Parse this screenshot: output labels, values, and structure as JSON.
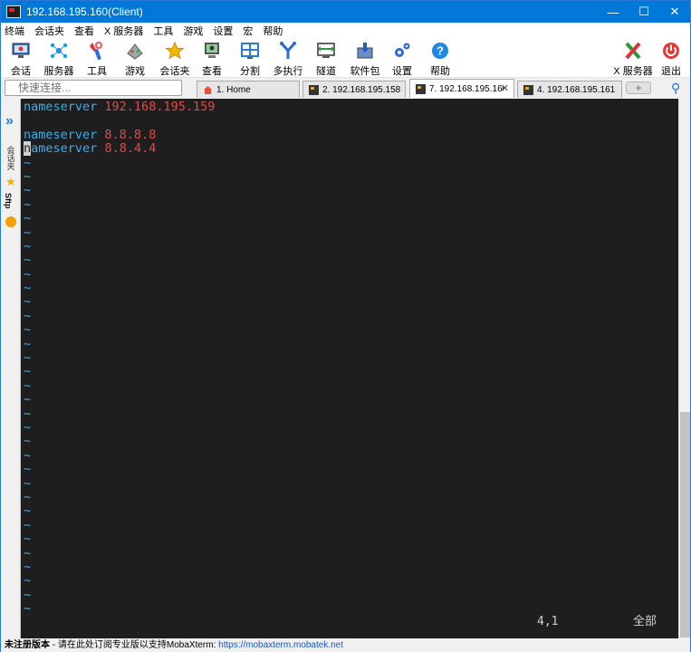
{
  "window": {
    "title": "192.168.195.160(Client)",
    "controls": {
      "minimize": "—",
      "maximize": "☐",
      "close": "✕"
    }
  },
  "menu": [
    "终端",
    "会话夹",
    "查看",
    "X 服务器",
    "工具",
    "游戏",
    "设置",
    "宏",
    "帮助"
  ],
  "toolbar": {
    "left": [
      {
        "label": "会话",
        "icon": "session-icon"
      },
      {
        "label": "服务器",
        "icon": "servers-icon"
      },
      {
        "label": "工具",
        "icon": "tools-icon"
      },
      {
        "label": "游戏",
        "icon": "games-icon"
      },
      {
        "label": "会话夹",
        "icon": "star-icon"
      },
      {
        "label": "查看",
        "icon": "view-icon"
      },
      {
        "label": "分割",
        "icon": "split-icon"
      },
      {
        "label": "多执行",
        "icon": "multiexec-icon"
      },
      {
        "label": "隧道",
        "icon": "tunnel-icon"
      },
      {
        "label": "软件包",
        "icon": "packages-icon"
      },
      {
        "label": "设置",
        "icon": "settings-icon"
      },
      {
        "label": "帮助",
        "icon": "help-icon"
      }
    ],
    "right": [
      {
        "label": "X 服务器",
        "icon": "x-server-icon"
      },
      {
        "label": "退出",
        "icon": "power-icon"
      }
    ]
  },
  "quick_connect": {
    "placeholder": "快速连接..."
  },
  "tabs": [
    {
      "label": "1. Home",
      "icon": "home-icon",
      "active": false
    },
    {
      "label": "2. 192.168.195.158",
      "icon": "terminal-tab-icon",
      "active": false
    },
    {
      "label": "7. 192.168.195.160",
      "icon": "terminal-tab-icon",
      "active": true
    },
    {
      "label": "4. 192.168.195.161",
      "icon": "terminal-tab-icon",
      "active": false
    }
  ],
  "sidebar": {
    "sessions_label": "会话夹",
    "sftp_label": "Sftp"
  },
  "terminal": {
    "lines": [
      {
        "keyword": "nameserver",
        "value": "192.168.195.159"
      },
      {
        "keyword": "",
        "value": ""
      },
      {
        "keyword": "nameserver",
        "value": "8.8.8.8"
      },
      {
        "keyword": "nameserver",
        "value": "8.8.4.4",
        "cursor": true
      }
    ],
    "tilde": "~",
    "tilde_count": 33,
    "position": "4,1",
    "scope": "全部"
  },
  "status_bar": {
    "unregistered": "未注册版本",
    "message": " - 请在此处订阅专业版以支持MobaXterm:  ",
    "link": "https://mobaxterm.mobatek.net"
  },
  "colors": {
    "accent": "#0078d7",
    "terminal_bg": "#1e1e1e",
    "keyword": "#3daee9",
    "value": "#e34a4a"
  }
}
